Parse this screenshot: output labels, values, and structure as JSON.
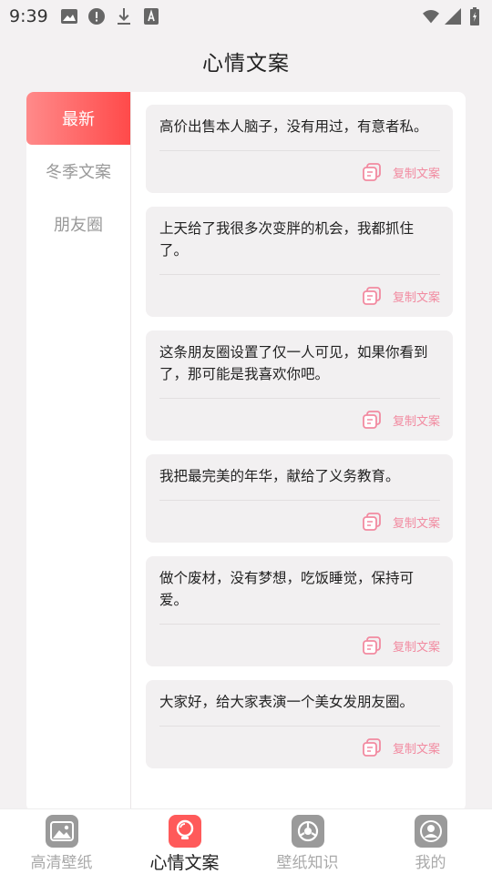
{
  "status": {
    "time": "9:39"
  },
  "page": {
    "title": "心情文案"
  },
  "sidebar": {
    "items": [
      {
        "label": "最新",
        "active": true
      },
      {
        "label": "冬季文案",
        "active": false
      },
      {
        "label": "朋友圈",
        "active": false
      }
    ]
  },
  "cards": [
    {
      "text": "高价出售本人脑子，没有用过，有意者私。",
      "action": "复制文案"
    },
    {
      "text": "上天给了我很多次变胖的机会，我都抓住了。",
      "action": "复制文案"
    },
    {
      "text": "这条朋友圈设置了仅一人可见，如果你看到了，那可能是我喜欢你吧。",
      "action": "复制文案"
    },
    {
      "text": "我把最完美的年华，献给了义务教育。",
      "action": "复制文案"
    },
    {
      "text": "做个废材，没有梦想，吃饭睡觉，保持可爱。",
      "action": "复制文案"
    },
    {
      "text": "大家好，给大家表演一个美女发朋友圈。",
      "action": "复制文案"
    }
  ],
  "tabbar": {
    "items": [
      {
        "label": "高清壁纸",
        "icon": "image-icon",
        "color": "#9a9a9a"
      },
      {
        "label": "心情文案",
        "icon": "bulb-icon",
        "color": "#ff5a5a"
      },
      {
        "label": "壁纸知识",
        "icon": "shutter-icon",
        "color": "#9a9a9a"
      },
      {
        "label": "我的",
        "icon": "user-icon",
        "color": "#9a9a9a"
      }
    ]
  },
  "colors": {
    "accent": "#ff4a4a",
    "copy": "#f28aa0",
    "background": "#f3f1f2"
  }
}
